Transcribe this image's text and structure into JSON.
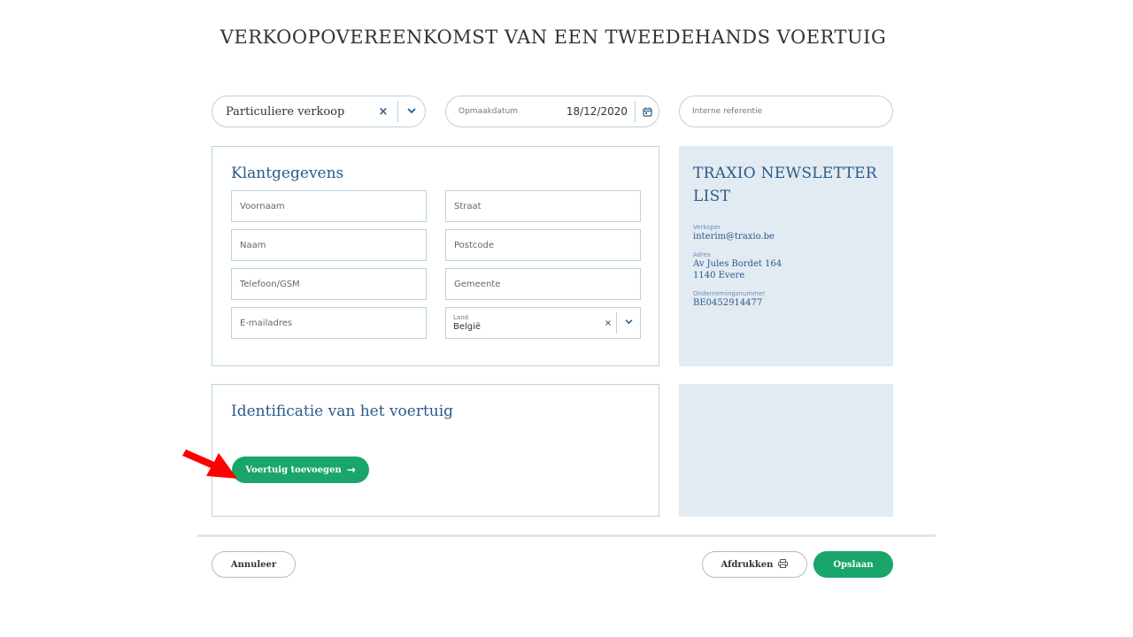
{
  "page": {
    "title": "VERKOOPOVEREENKOMST VAN EEN TWEEDEHANDS VOERTUIG"
  },
  "top_controls": {
    "sale_type": {
      "value": "Particuliere verkoop",
      "clear_icon": "×",
      "chevron_icon": "⌄"
    },
    "date": {
      "label": "Opmaakdatum",
      "value": "18/12/2020"
    },
    "reference": {
      "placeholder": "Interne referentie"
    }
  },
  "client": {
    "title": "Klantgegevens",
    "fields": {
      "first_name": "Voornaam",
      "street": "Straat",
      "last_name": "Naam",
      "postcode": "Postcode",
      "phone": "Telefoon/GSM",
      "municipality": "Gemeente",
      "email": "E-mailadres"
    },
    "country": {
      "label": "Land",
      "value": "België",
      "clear_icon": "×",
      "chevron_icon": "⌄"
    }
  },
  "info": {
    "title": "TRAXIO NEWSLETTER LIST",
    "seller_label": "Verkoper",
    "seller_value": "interim@traxio.be",
    "address_label": "Adres",
    "address_line1": "Av Jules Bordet 164",
    "address_line2": "1140 Evere",
    "company_label": "Ondernemingsnummer",
    "company_value": "BE0452914477"
  },
  "vehicle": {
    "title": "Identificatie van het voertuig",
    "add_button": "Voertuig toevoegen",
    "add_arrow": "→"
  },
  "footer": {
    "cancel": "Annuleer",
    "print": "Afdrukken",
    "save": "Opslaan"
  },
  "colors": {
    "accent_blue": "#2a5a8a",
    "green": "#1aa56a",
    "panel_bg": "#e2eaf2",
    "border": "#b9d2dd",
    "annotation_red": "#ff0000"
  }
}
